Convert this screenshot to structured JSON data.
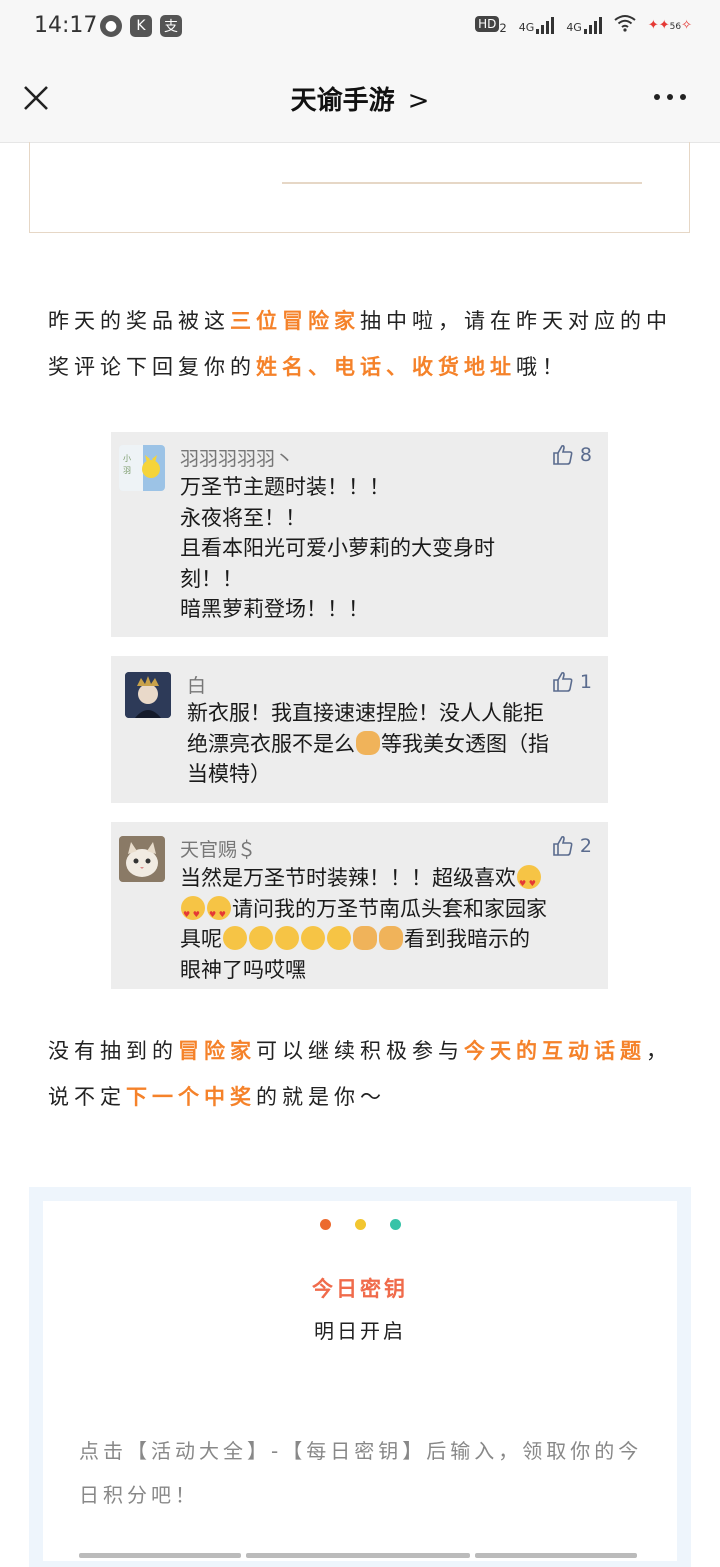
{
  "status": {
    "time": "14:17",
    "hd": "HD",
    "hd_sub": "2",
    "net1": "4G",
    "net2": "4G",
    "battery": "56"
  },
  "nav": {
    "title": "天谕手游",
    "chevron": ">"
  },
  "intro": {
    "t1": "昨天的奖品被这",
    "h1": "三位冒险家",
    "t2": "抽中啦，请在昨天对应的中奖评论下回复你的",
    "h2": "姓名、电话、收货地址",
    "t3": "哦！"
  },
  "comments": [
    {
      "name": "羽羽羽羽羽丶",
      "likes": "8",
      "lines": [
        "万圣节主题时装！！！",
        "永夜将至！！",
        "且看本阳光可爱小萝莉的大变身时",
        "刻！！",
        "暗黑萝莉登场！！！"
      ]
    },
    {
      "name": "白",
      "likes": "1",
      "line1": "新衣服！我直接速速捏脸！没人人能拒",
      "line2a": "绝漂亮衣服不是么",
      "line2b": "等我美女透图（指",
      "line3": "当模特）"
    },
    {
      "name": "天官赐＄",
      "likes": "2",
      "line1": "当然是万圣节时装辣！！！超级喜欢",
      "line2": "请问我的万圣节南瓜头套和家园家",
      "line3a": "具呢",
      "line3b": "看到我暗示的",
      "line4": "眼神了吗哎嘿"
    }
  ],
  "outro": {
    "t1": "没有抽到的",
    "h1": "冒险家",
    "t2": "可以继续积极参与",
    "h2": "今天的互动话题",
    "t3": "，说不定",
    "h3": "下一个中奖",
    "t4": "的就是你～"
  },
  "panel": {
    "dot_colors": [
      "#ec6a2f",
      "#f2c630",
      "#37c3a8"
    ],
    "title": "今日密钥",
    "subtitle": "明日开启",
    "hint": "点击【活动大全】-【每日密钥】后输入，领取你的今日积分吧！"
  },
  "colors": {
    "highlight": "#f5822a",
    "like": "#5b6c8e",
    "key_title": "#f06b4b"
  }
}
